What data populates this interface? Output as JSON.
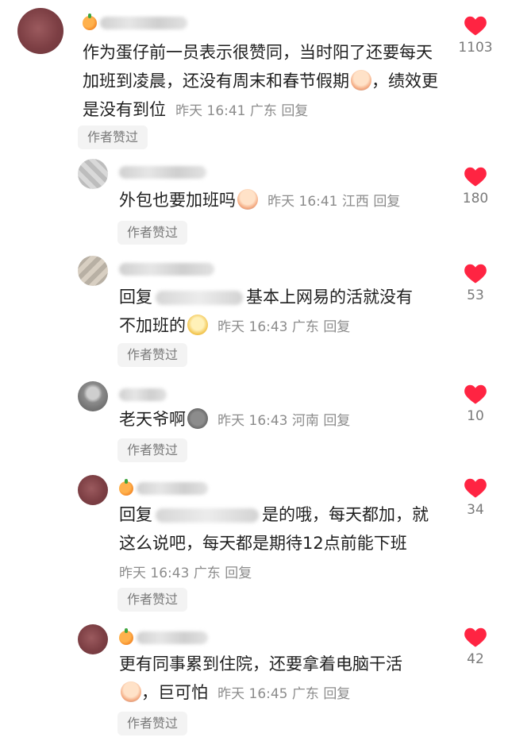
{
  "comments": [
    {
      "text": "作为蛋仔前一员表示很赞同，当时阳了还要每天加班到凌晨，还没有周末和春节假期",
      "text2": "，绩效更是没有到位",
      "time": "昨天 16:41",
      "location": "广东",
      "reply": "回复",
      "liked_by_author": "作者赞过",
      "likes": "1103"
    },
    {
      "text": "外包也要加班吗",
      "time": "昨天 16:41",
      "location": "江西",
      "reply": "回复",
      "liked_by_author": "作者赞过",
      "likes": "180"
    },
    {
      "prefix": "回复",
      "text": "基本上网易的活就没有",
      "text2": "不加班的",
      "time": "昨天 16:43",
      "location": "广东",
      "reply": "回复",
      "liked_by_author": "作者赞过",
      "likes": "53"
    },
    {
      "text": "老天爷啊",
      "time": "昨天 16:43",
      "location": "河南",
      "reply": "回复",
      "liked_by_author": "作者赞过",
      "likes": "10"
    },
    {
      "prefix": "回复",
      "text": "是的哦，每天都加，就",
      "text2": "这么说吧，每天都是期待12点前能下班",
      "time": "昨天 16:43",
      "location": "广东",
      "reply": "回复",
      "liked_by_author": "作者赞过",
      "likes": "34"
    },
    {
      "text": "更有同事累到住院，还要拿着电脑干活",
      "text2": "，巨可怕",
      "time": "昨天 16:45",
      "location": "广东",
      "reply": "回复",
      "liked_by_author": "作者赞过",
      "likes": "42"
    }
  ],
  "colors": {
    "heart": "#ff2442",
    "meta": "#8c8c8c"
  }
}
